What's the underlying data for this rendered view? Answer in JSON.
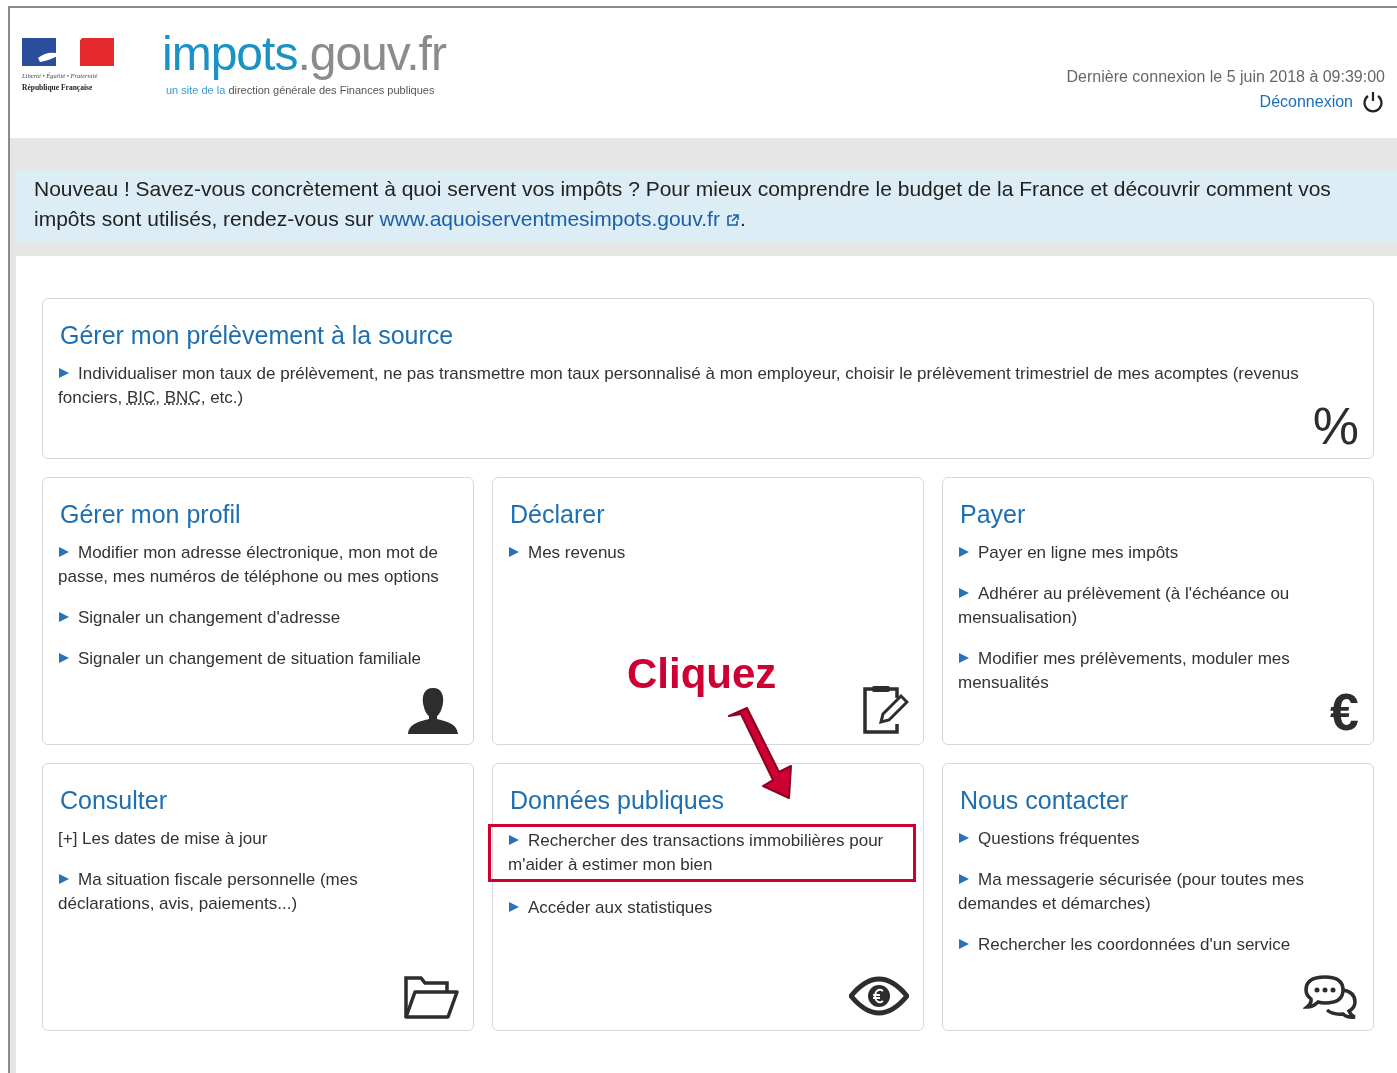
{
  "header": {
    "republic_logo": {
      "motto": "Liberté • Égalité • Fraternité",
      "name": "République Française"
    },
    "brand": {
      "main": "impots",
      "suffix": ".gouv.fr",
      "tagline_lead": "un site de la",
      "tagline_rest": "direction générale des Finances publiques"
    },
    "last_login": "Dernière connexion le 5 juin 2018 à 09:39:00",
    "logout": "Déconnexion"
  },
  "notice": {
    "text": "Nouveau ! Savez-vous concrètement à quoi servent vos impôts ? Pour mieux comprendre le budget de la France et découvrir comment vos impôts sont utilisés, rendez-vous sur",
    "link": "www.aquoiserventmesimpots.gouv.fr",
    "after": "."
  },
  "cards": [
    {
      "title": "Gérer mon prélèvement à la source",
      "glyph": "%",
      "items": [
        {
          "kind": "bullet",
          "highlighted": false,
          "parts": [
            {
              "kind": "text",
              "text": "Individualiser mon taux de prélèvement, ne pas transmettre mon taux personnalisé à mon employeur, choisir le prélèvement trimestriel de mes acomptes (revenus fonciers, "
            },
            {
              "kind": "abbr",
              "text": "BIC"
            },
            {
              "kind": "text",
              "text": ", "
            },
            {
              "kind": "abbr",
              "text": "BNC"
            },
            {
              "kind": "text",
              "text": ", etc.)"
            }
          ]
        }
      ]
    },
    {
      "title": "Gérer mon profil",
      "items": [
        {
          "kind": "bullet",
          "highlighted": false,
          "parts": [
            {
              "kind": "text",
              "text": "Modifier mon adresse électronique, mon mot de passe, mes numéros de téléphone ou mes options"
            }
          ]
        },
        {
          "kind": "bullet",
          "highlighted": false,
          "parts": [
            {
              "kind": "text",
              "text": "Signaler un changement d'adresse"
            }
          ]
        },
        {
          "kind": "bullet",
          "highlighted": false,
          "parts": [
            {
              "kind": "text",
              "text": "Signaler un changement de situation familiale"
            }
          ]
        }
      ]
    },
    {
      "title": "Déclarer",
      "items": [
        {
          "kind": "bullet",
          "highlighted": false,
          "parts": [
            {
              "kind": "text",
              "text": "Mes revenus"
            }
          ]
        }
      ]
    },
    {
      "title": "Payer",
      "glyph": "€",
      "items": [
        {
          "kind": "bullet",
          "highlighted": false,
          "parts": [
            {
              "kind": "text",
              "text": "Payer en ligne mes impôts"
            }
          ]
        },
        {
          "kind": "bullet",
          "highlighted": false,
          "parts": [
            {
              "kind": "text",
              "text": "Adhérer au prélèvement (à l'échéance ou mensualisation)"
            }
          ]
        },
        {
          "kind": "bullet",
          "highlighted": false,
          "parts": [
            {
              "kind": "text",
              "text": "Modifier mes prélèvements, moduler mes mensualités"
            }
          ]
        }
      ]
    },
    {
      "title": "Consulter",
      "items": [
        {
          "kind": "plain",
          "highlighted": false,
          "parts": [
            {
              "kind": "text",
              "text": "[+] Les dates de mise à jour"
            }
          ]
        },
        {
          "kind": "bullet",
          "highlighted": false,
          "parts": [
            {
              "kind": "text",
              "text": "Ma situation fiscale personnelle (mes déclarations, avis, paiements...)"
            }
          ]
        }
      ]
    },
    {
      "title": "Données publiques",
      "items": [
        {
          "kind": "bullet",
          "highlighted": true,
          "parts": [
            {
              "kind": "text",
              "text": "Rechercher des transactions immobilières pour m'aider à estimer mon bien"
            }
          ]
        },
        {
          "kind": "bullet",
          "highlighted": false,
          "parts": [
            {
              "kind": "text",
              "text": "Accéder aux statistiques"
            }
          ]
        }
      ]
    },
    {
      "title": "Nous contacter",
      "items": [
        {
          "kind": "bullet",
          "highlighted": false,
          "parts": [
            {
              "kind": "text",
              "text": "Questions fréquentes"
            }
          ]
        },
        {
          "kind": "bullet",
          "highlighted": false,
          "parts": [
            {
              "kind": "text",
              "text": "Ma messagerie sécurisée (pour toutes mes demandes et démarches)"
            }
          ]
        },
        {
          "kind": "bullet",
          "highlighted": false,
          "parts": [
            {
              "kind": "text",
              "text": "Rechercher les coordonnées d'un service"
            }
          ]
        }
      ]
    }
  ],
  "annotation": {
    "text": "Cliquez"
  }
}
